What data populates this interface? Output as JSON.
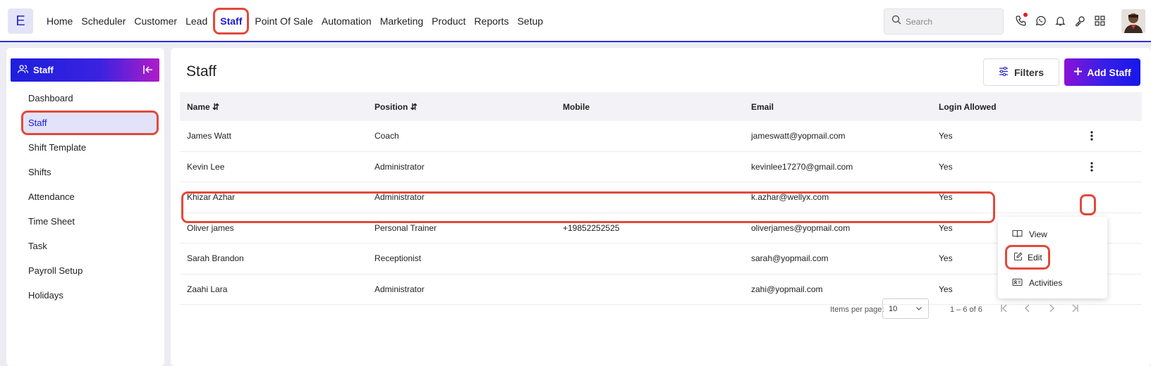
{
  "logo": {
    "letter": "E"
  },
  "nav": {
    "items": [
      "Home",
      "Scheduler",
      "Customer",
      "Lead",
      "Staff",
      "Point Of Sale",
      "Automation",
      "Marketing",
      "Product",
      "Reports",
      "Setup"
    ],
    "active": "Staff"
  },
  "search": {
    "placeholder": "Search"
  },
  "sidebar": {
    "title": "Staff",
    "items": [
      "Dashboard",
      "Staff",
      "Shift Template",
      "Shifts",
      "Attendance",
      "Time Sheet",
      "Task",
      "Payroll Setup",
      "Holidays"
    ],
    "active": "Staff"
  },
  "main": {
    "title": "Staff",
    "filters_label": "Filters",
    "add_label": "Add Staff"
  },
  "table": {
    "headers": {
      "name": "Name",
      "position": "Position",
      "mobile": "Mobile",
      "email": "Email",
      "login": "Login Allowed"
    },
    "rows": [
      {
        "name": "James Watt",
        "position": "Coach",
        "mobile": "",
        "email": "jameswatt@yopmail.com",
        "login": "Yes"
      },
      {
        "name": "Kevin Lee",
        "position": "Administrator",
        "mobile": "",
        "email": "kevinlee17270@gmail.com",
        "login": "Yes"
      },
      {
        "name": "Khizar Azhar",
        "position": "Administrator",
        "mobile": "",
        "email": "k.azhar@wellyx.com",
        "login": "Yes"
      },
      {
        "name": "Oliver james",
        "position": "Personal Trainer",
        "mobile": "+19852252525",
        "email": "oliverjames@yopmail.com",
        "login": "Yes"
      },
      {
        "name": "Sarah Brandon",
        "position": "Receptionist",
        "mobile": "",
        "email": "sarah@yopmail.com",
        "login": "Yes"
      },
      {
        "name": "Zaahi Lara",
        "position": "Administrator",
        "mobile": "",
        "email": "zahi@yopmail.com",
        "login": "Yes"
      }
    ]
  },
  "row_menu": {
    "view": "View",
    "edit": "Edit",
    "activities": "Activities"
  },
  "pagination": {
    "items_per_page_label": "Items per page:",
    "page_size": "10",
    "range": "1 – 6 of 6"
  },
  "colors": {
    "accent": "#1a1ad6",
    "highlight": "#e2493b",
    "gradient_start": "#8a12d8",
    "gradient_end": "#1717ea"
  }
}
